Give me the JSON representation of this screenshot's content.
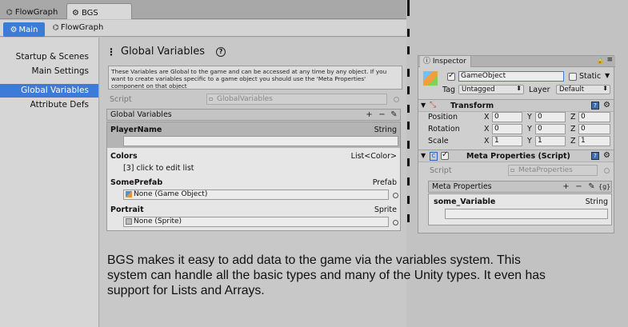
{
  "tabs": [
    {
      "label": "FlowGraph",
      "icon": "hierarchy-icon"
    },
    {
      "label": "BGS",
      "icon": "unity-gear-icon"
    }
  ],
  "subtoolbar": {
    "main_label": "Main",
    "flowgraph_label": "FlowGraph"
  },
  "sidebar": {
    "items": [
      {
        "label": "Startup & Scenes"
      },
      {
        "label": "Main Settings"
      },
      {
        "label": "Global Variables"
      },
      {
        "label": "Attribute Defs"
      }
    ]
  },
  "main": {
    "title": "Global Variables",
    "help_icon": "question-circle-icon",
    "info": "These Variables are Global to the game and can be accessed at any time by any object. If you want to create variables specific to a game object you should use the 'Meta Properties' component on that object",
    "script_label": "Script",
    "script_value": "GlobalVariables",
    "list_header": "Global Variables",
    "list_buttons": {
      "add": "+",
      "remove": "−",
      "edit": "✎"
    },
    "variables": [
      {
        "name": "PlayerName",
        "type": "String",
        "value": ""
      },
      {
        "name": "Colors",
        "type": "List<Color>",
        "value": "[3] click to edit list"
      },
      {
        "name": "SomePrefab",
        "type": "Prefab",
        "value": "None (Game Object)"
      },
      {
        "name": "Portrait",
        "type": "Sprite",
        "value": "None (Sprite)"
      }
    ]
  },
  "inspector": {
    "tab_label": "Inspector",
    "object_name": "GameObject",
    "static_label": "Static",
    "tag_label": "Tag",
    "tag_value": "Untagged",
    "layer_label": "Layer",
    "layer_value": "Default",
    "transform": {
      "title": "Transform",
      "rows": [
        {
          "label": "Position",
          "x": "0",
          "y": "0",
          "z": "0"
        },
        {
          "label": "Rotation",
          "x": "0",
          "y": "0",
          "z": "0"
        },
        {
          "label": "Scale",
          "x": "1",
          "y": "1",
          "z": "1"
        }
      ],
      "axis_x": "X",
      "axis_y": "Y",
      "axis_z": "Z"
    },
    "meta": {
      "title": "Meta Properties (Script)",
      "script_label": "Script",
      "script_value": "MetaProperties",
      "list_header": "Meta Properties",
      "list_buttons": {
        "add": "+",
        "remove": "−",
        "edit": "✎",
        "g": "{g}"
      },
      "var_name": "some_Variable",
      "var_type": "String"
    }
  },
  "caption": "BGS makes it easy to add data to the game via the variables system. This system can handle all the basic types and many of the Unity types. It even has support for Lists and Arrays.",
  "colors": {
    "accent": "#3d7cd6",
    "background": "#c2c2c2",
    "panel": "#e6e6e6"
  }
}
